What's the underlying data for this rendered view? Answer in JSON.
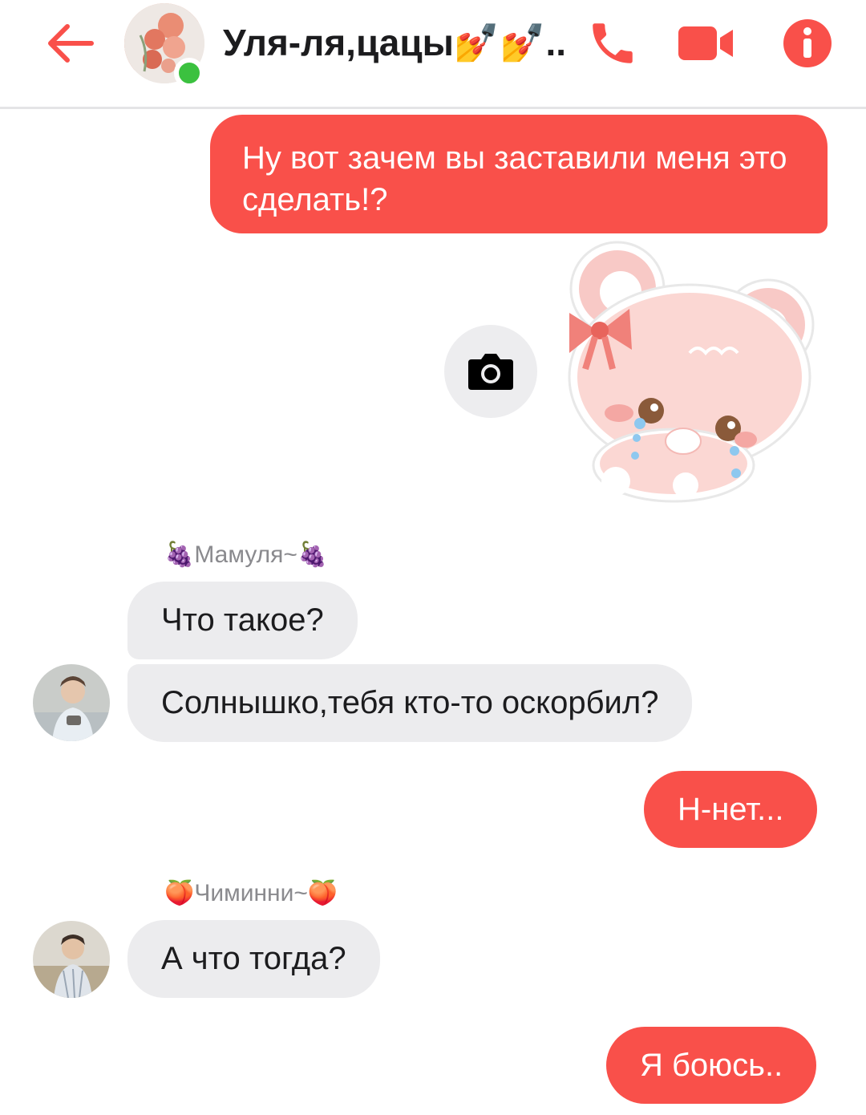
{
  "header": {
    "title": "Уля-ля,цацы💅💅...",
    "back_icon": "arrow-left-icon",
    "call_icon": "phone-icon",
    "video_icon": "video-camera-icon",
    "info_icon": "info-icon",
    "accent_color": "#f9504a",
    "online_color": "#3bc13f"
  },
  "messages": [
    {
      "direction": "out",
      "text": "Ну вот зачем вы заставили меня это сделать!?"
    },
    {
      "direction": "out",
      "type": "sticker",
      "sticker": "crying-pink-bear-sticker"
    },
    {
      "direction": "in",
      "sender": "🍇Мамуля~🍇",
      "text": "Что такое?"
    },
    {
      "direction": "in",
      "text": "Солнышко,тебя кто-то оскорбил?"
    },
    {
      "direction": "out",
      "text": "Н-нет..."
    },
    {
      "direction": "in",
      "sender": "🍑Чиминни~🍑",
      "text": "А что тогда?"
    },
    {
      "direction": "out",
      "text": "Я боюсь.."
    }
  ],
  "camera_button_icon": "camera-icon"
}
